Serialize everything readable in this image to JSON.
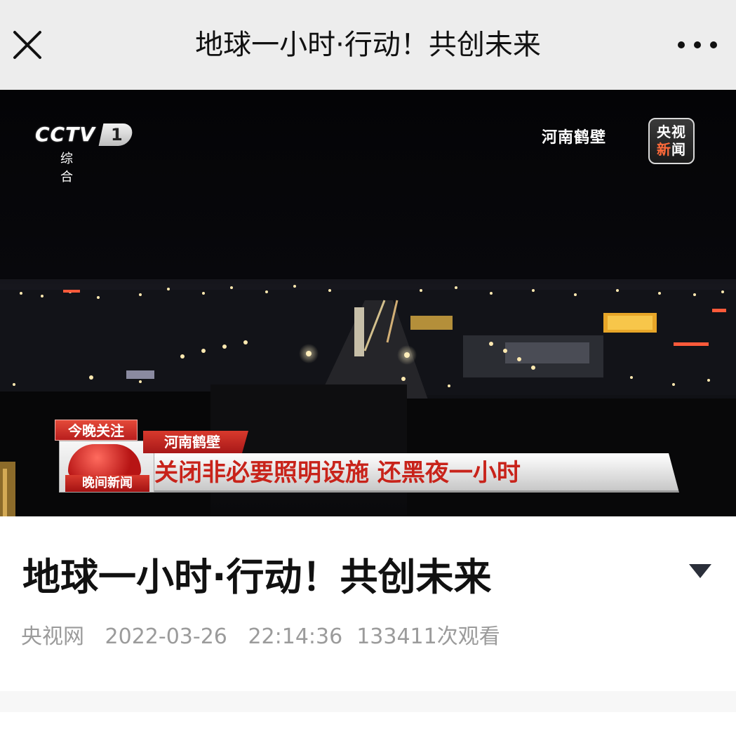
{
  "header": {
    "title": "地球一小时·行动！共创未来",
    "close_icon": "close-icon",
    "more_icon": "more-icon"
  },
  "video": {
    "channel_logo": "CCTV",
    "channel_number": "1",
    "channel_name": "综 合",
    "location": "河南鹤壁",
    "news_logo_line1": "央视",
    "news_logo_line2_a": "新",
    "news_logo_line2_b": "闻",
    "banner": {
      "tonight_tag": "今晚关注",
      "program": "晚间新闻",
      "place": "河南鹤壁",
      "headline": "关闭非必要照明设施 还黑夜一小时"
    }
  },
  "article": {
    "title": "地球一小时·行动！共创未来",
    "source": "央视网",
    "date": "2022-03-26",
    "time": "22:14:36",
    "views": "133411次观看"
  },
  "colors": {
    "topbar_bg": "#ededed",
    "headline_red": "#c8231a",
    "meta_gray": "#9b9b9b"
  }
}
